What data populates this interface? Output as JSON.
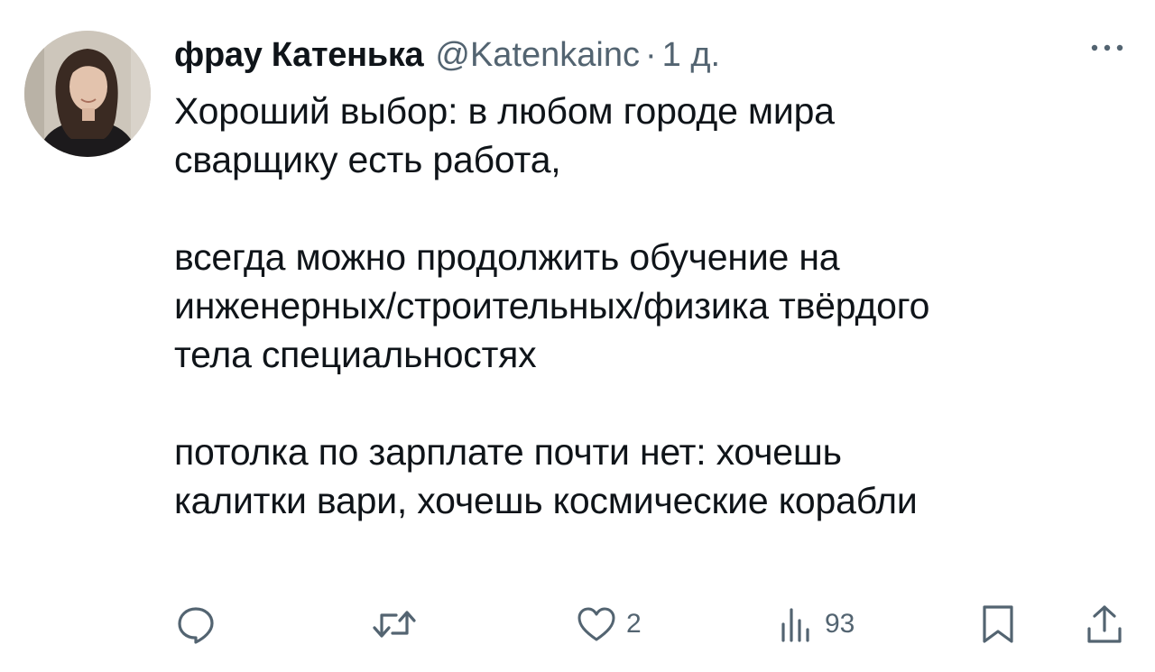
{
  "tweet": {
    "author": {
      "display_name": "фрау Катенька",
      "handle": "@Katenkainc",
      "separator": "·",
      "time": "1 д."
    },
    "text": {
      "paragraphs": [
        {
          "lines": [
            "Хороший выбор: в любом городе мира",
            "сварщику есть работа,"
          ]
        },
        {
          "lines": [
            "всегда можно продолжить обучение на",
            "инженерных/строительных/физика твёрдого",
            "тела специальностях"
          ]
        },
        {
          "lines": [
            "потолка по зарплате почти нет: хочешь",
            "калитки вари, хочешь космические корабли"
          ]
        }
      ]
    },
    "actions": {
      "reply": {
        "icon": "reply-icon",
        "count": ""
      },
      "retweet": {
        "icon": "retweet-icon",
        "count": ""
      },
      "like": {
        "icon": "heart-icon",
        "count": "2"
      },
      "views": {
        "icon": "views-bar-chart-icon",
        "count": "93"
      },
      "bookmark": {
        "icon": "bookmark-icon"
      },
      "share": {
        "icon": "share-icon"
      }
    },
    "more_icon": "more-dots-icon"
  },
  "colors": {
    "text_primary": "#0f1419",
    "text_secondary": "#536471",
    "background": "#ffffff"
  }
}
